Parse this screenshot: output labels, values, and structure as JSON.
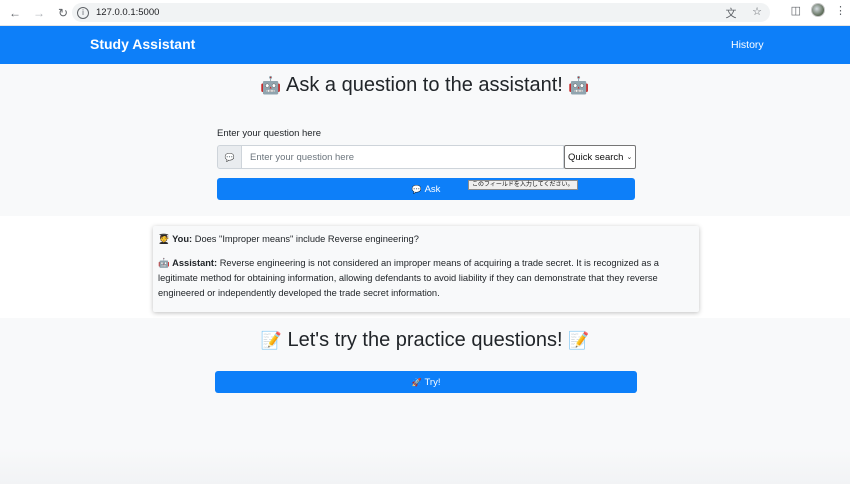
{
  "browser": {
    "url": "127.0.0.1:5000",
    "back_icon": "arrow-left",
    "forward_icon": "arrow-right",
    "reload_icon": "reload",
    "translate_icon": "translate",
    "star_icon": "star",
    "extensions_icon": "puzzle",
    "menu_icon": "kebab"
  },
  "navbar": {
    "brand": "Study Assistant",
    "history_link": "History",
    "color": "#0d7ff9"
  },
  "ask": {
    "heading_emoji_left": "🤖",
    "heading": "Ask a question to the assistant!",
    "heading_emoji_right": "🤖",
    "input_label": "Enter your question here",
    "input_icon": "💬",
    "input_value": "",
    "input_placeholder": "Enter your question here",
    "mode_select": "Quick search",
    "ask_button_icon": "💬",
    "ask_button": "Ask",
    "tooltip": "このフィールドを入力してください。"
  },
  "chat": {
    "user_emoji": "🧑‍🎓",
    "user_label": "You:",
    "user_message": "Does \"Improper means\" include Reverse engineering?",
    "assistant_emoji": "🤖",
    "assistant_label": "Assistant:",
    "assistant_message": "Reverse engineering is not considered an improper means of acquiring a trade secret. It is recognized as a legitimate method for obtaining information, allowing defendants to avoid liability if they can demonstrate that they reverse engineered or independently developed the trade secret information."
  },
  "practice": {
    "heading_emoji_left": "📝",
    "heading": "Let's try the practice questions!",
    "heading_emoji_right": "📝",
    "try_button_icon": "🚀",
    "try_button": "Try!"
  }
}
